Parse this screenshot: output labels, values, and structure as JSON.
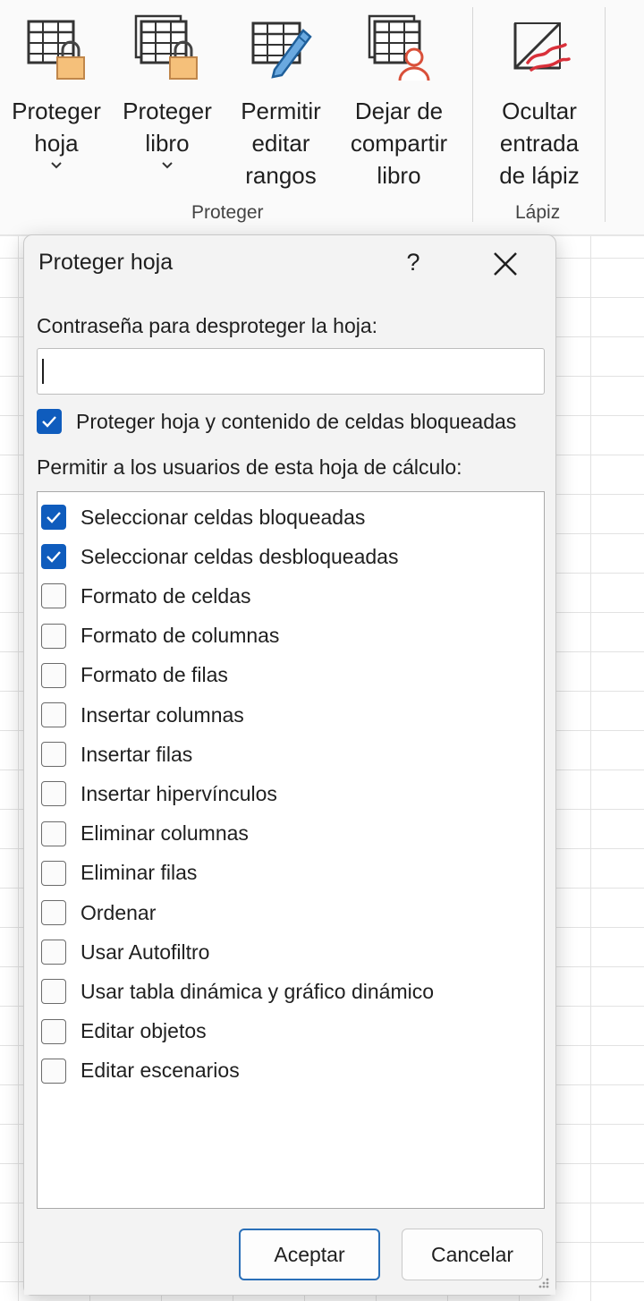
{
  "ribbon": {
    "buttons": [
      {
        "label": "Proteger\nhoja",
        "icon": "protect-sheet-icon",
        "dropdown": true
      },
      {
        "label": "Proteger\nlibro",
        "icon": "protect-workbook-icon",
        "dropdown": true
      },
      {
        "label": "Permitir\neditar\nrangos",
        "icon": "allow-edit-ranges-icon",
        "dropdown": false
      },
      {
        "label": "Dejar de\ncompartir\nlibro",
        "icon": "unshare-workbook-icon",
        "dropdown": false
      },
      {
        "label": "Ocultar\nentrada\nde lápiz",
        "icon": "hide-ink-icon",
        "dropdown": false
      }
    ],
    "groups": {
      "protect": "Proteger",
      "ink": "Lápiz"
    }
  },
  "dialog": {
    "title": "Proteger hoja",
    "help": "?",
    "password_label": "Contraseña para desproteger la hoja:",
    "password_value": "",
    "protect_option": {
      "label": "Proteger hoja y contenido de celdas bloqueadas",
      "checked": true
    },
    "allow_label": "Permitir a los usuarios de esta hoja de cálculo:",
    "permissions": [
      {
        "label": "Seleccionar celdas bloqueadas",
        "checked": true
      },
      {
        "label": "Seleccionar celdas desbloqueadas",
        "checked": true
      },
      {
        "label": "Formato de celdas",
        "checked": false
      },
      {
        "label": "Formato de columnas",
        "checked": false
      },
      {
        "label": "Formato de filas",
        "checked": false
      },
      {
        "label": "Insertar columnas",
        "checked": false
      },
      {
        "label": "Insertar filas",
        "checked": false
      },
      {
        "label": "Insertar hipervínculos",
        "checked": false
      },
      {
        "label": "Eliminar columnas",
        "checked": false
      },
      {
        "label": "Eliminar filas",
        "checked": false
      },
      {
        "label": "Ordenar",
        "checked": false
      },
      {
        "label": "Usar Autofiltro",
        "checked": false
      },
      {
        "label": "Usar tabla dinámica y gráfico dinámico",
        "checked": false
      },
      {
        "label": "Editar objetos",
        "checked": false
      },
      {
        "label": "Editar escenarios",
        "checked": false
      }
    ],
    "ok_label": "Aceptar",
    "cancel_label": "Cancelar"
  },
  "colors": {
    "accent": "#0f5cbd",
    "primary_border": "#2a6fb8",
    "lock": "#f5c07a",
    "ink": "#d9303a"
  }
}
